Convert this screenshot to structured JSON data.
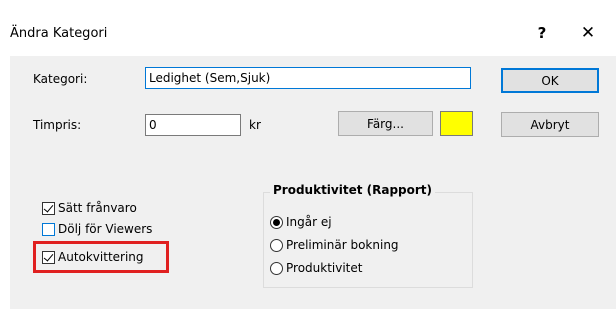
{
  "window": {
    "title": "Ändra Kategori",
    "help_label": "?",
    "close_label": "✕"
  },
  "form": {
    "kategori_label": "Kategori:",
    "kategori_value": "Ledighet (Sem,Sjuk)",
    "timpris_label": "Timpris:",
    "timpris_value": "0",
    "currency_label": "kr",
    "color_button_label": "Färg...",
    "color_swatch": "#ffff00"
  },
  "buttons": {
    "ok_label": "OK",
    "cancel_label": "Avbryt"
  },
  "checkboxes": [
    {
      "label": "Sätt frånvaro",
      "checked": true
    },
    {
      "label": "Dölj för Viewers",
      "checked": false
    },
    {
      "label": "Autokvittering",
      "checked": true
    }
  ],
  "productivity": {
    "title": "Produktivitet (Rapport)",
    "options": [
      {
        "label": "Ingår ej",
        "selected": true
      },
      {
        "label": "Preliminär bokning",
        "selected": false
      },
      {
        "label": "Produktivitet",
        "selected": false
      }
    ]
  },
  "colors": {
    "highlight": "#e02020",
    "focus": "#0078d7"
  }
}
